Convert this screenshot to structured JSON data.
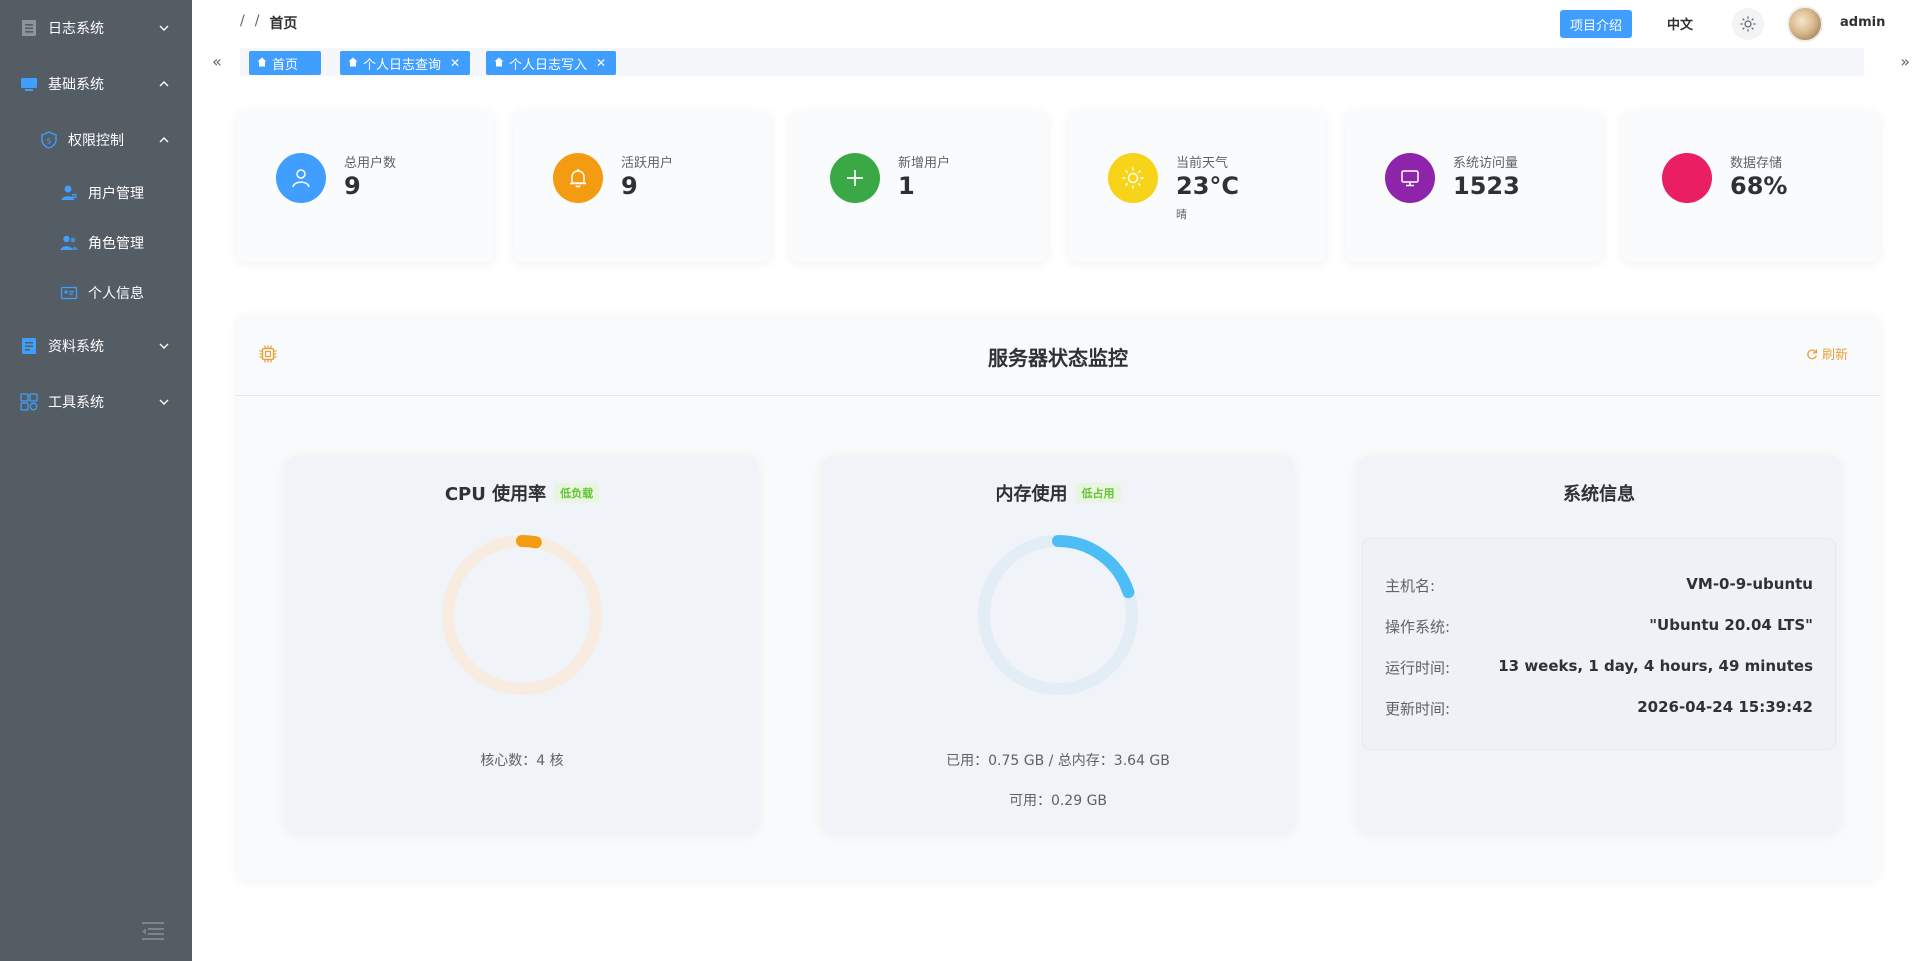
{
  "sidebar": {
    "items": [
      {
        "label": "日志系统",
        "icon": "list-icon",
        "expanded": false
      },
      {
        "label": "基础系统",
        "icon": "monitor-icon",
        "expanded": true
      },
      {
        "label": "权限控制",
        "icon": "shield-icon",
        "expanded": true
      },
      {
        "label": "用户管理",
        "icon": "user-icon"
      },
      {
        "label": "角色管理",
        "icon": "users-icon"
      },
      {
        "label": "个人信息",
        "icon": "id-card-icon"
      },
      {
        "label": "资料系统",
        "icon": "document-icon",
        "expanded": false
      },
      {
        "label": "工具系统",
        "icon": "grid-icon",
        "expanded": false
      }
    ]
  },
  "header": {
    "breadcrumb": [
      "/",
      "/",
      "首页"
    ],
    "intro_button": "项目介绍",
    "language": "中文",
    "username": "admin"
  },
  "tabs": [
    {
      "label": "首页",
      "closable": false
    },
    {
      "label": "个人日志查询",
      "closable": true
    },
    {
      "label": "个人日志写入",
      "closable": true
    }
  ],
  "stats": [
    {
      "label": "总用户数",
      "value": "9",
      "color": "#409eff",
      "icon": "user-icon"
    },
    {
      "label": "活跃用户",
      "value": "9",
      "color": "#f39c12",
      "icon": "bell-icon"
    },
    {
      "label": "新增用户",
      "value": "1",
      "color": "#3aa845",
      "icon": "plus-icon"
    },
    {
      "label": "当前天气",
      "value": "23°C",
      "sub": "晴",
      "color": "#f7d31a",
      "icon": "sun-icon"
    },
    {
      "label": "系统访问量",
      "value": "1523",
      "color": "#8e24aa",
      "icon": "monitor-icon"
    },
    {
      "label": "数据存储",
      "value": "68%",
      "color": "#e91e63",
      "icon": "circle-icon"
    }
  ],
  "monitor": {
    "title": "服务器状态监控",
    "refresh": "刷新",
    "cpu": {
      "title": "CPU 使用率",
      "badge": "低负载",
      "usage": 0.03,
      "cores_text": "核心数：4 核",
      "color": "#f39c12"
    },
    "memory": {
      "title": "内存使用",
      "badge": "低占用",
      "usage": 0.2,
      "used_text": "已用：0.75 GB / 总内存：3.64 GB",
      "available_text": "可用：0.29 GB",
      "color": "#4dbdf5"
    },
    "system": {
      "title": "系统信息",
      "rows": [
        {
          "key": "主机名:",
          "value": "VM-0-9-ubuntu"
        },
        {
          "key": "操作系统:",
          "value": "\"Ubuntu 20.04 LTS\""
        },
        {
          "key": "运行时间:",
          "value": "13 weeks, 1 day, 4 hours, 49 minutes"
        },
        {
          "key": "更新时间:",
          "value": "2026-04-24 15:39:42"
        }
      ]
    }
  }
}
